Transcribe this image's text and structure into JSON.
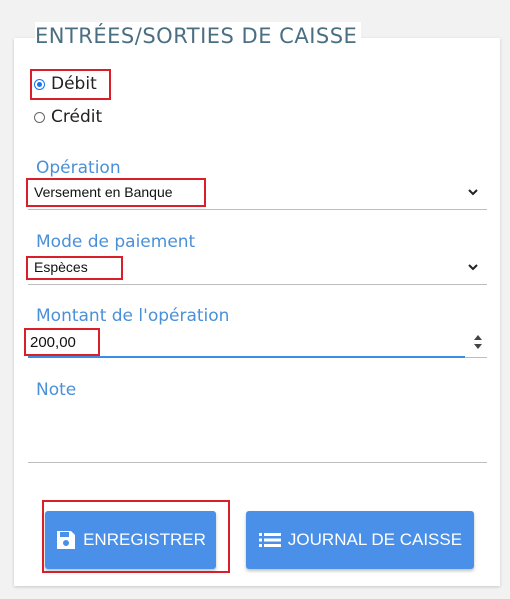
{
  "page": {
    "title": "ENTRÉES/SORTIES DE CAISSE"
  },
  "type_selector": {
    "options": [
      {
        "label": "Débit",
        "checked": true
      },
      {
        "label": "Crédit",
        "checked": false
      }
    ]
  },
  "operation": {
    "label": "Opération",
    "value": "Versement en Banque"
  },
  "payment_mode": {
    "label": "Mode de paiement",
    "value": "Espèces"
  },
  "amount": {
    "label": "Montant de l'opération",
    "value": "200,00"
  },
  "note": {
    "label": "Note",
    "value": ""
  },
  "actions": {
    "save_label": "ENREGISTRER",
    "journal_label": "JOURNAL DE CAISSE"
  },
  "colors": {
    "accent": "#4a90e8",
    "label": "#4a90d9",
    "title": "#4b6f82",
    "highlight": "#d9202a"
  },
  "icons": {
    "save": "floppy-disk-icon",
    "journal": "list-icon",
    "dropdown": "chevron-down-icon",
    "spinner": "number-spinner-icon"
  }
}
